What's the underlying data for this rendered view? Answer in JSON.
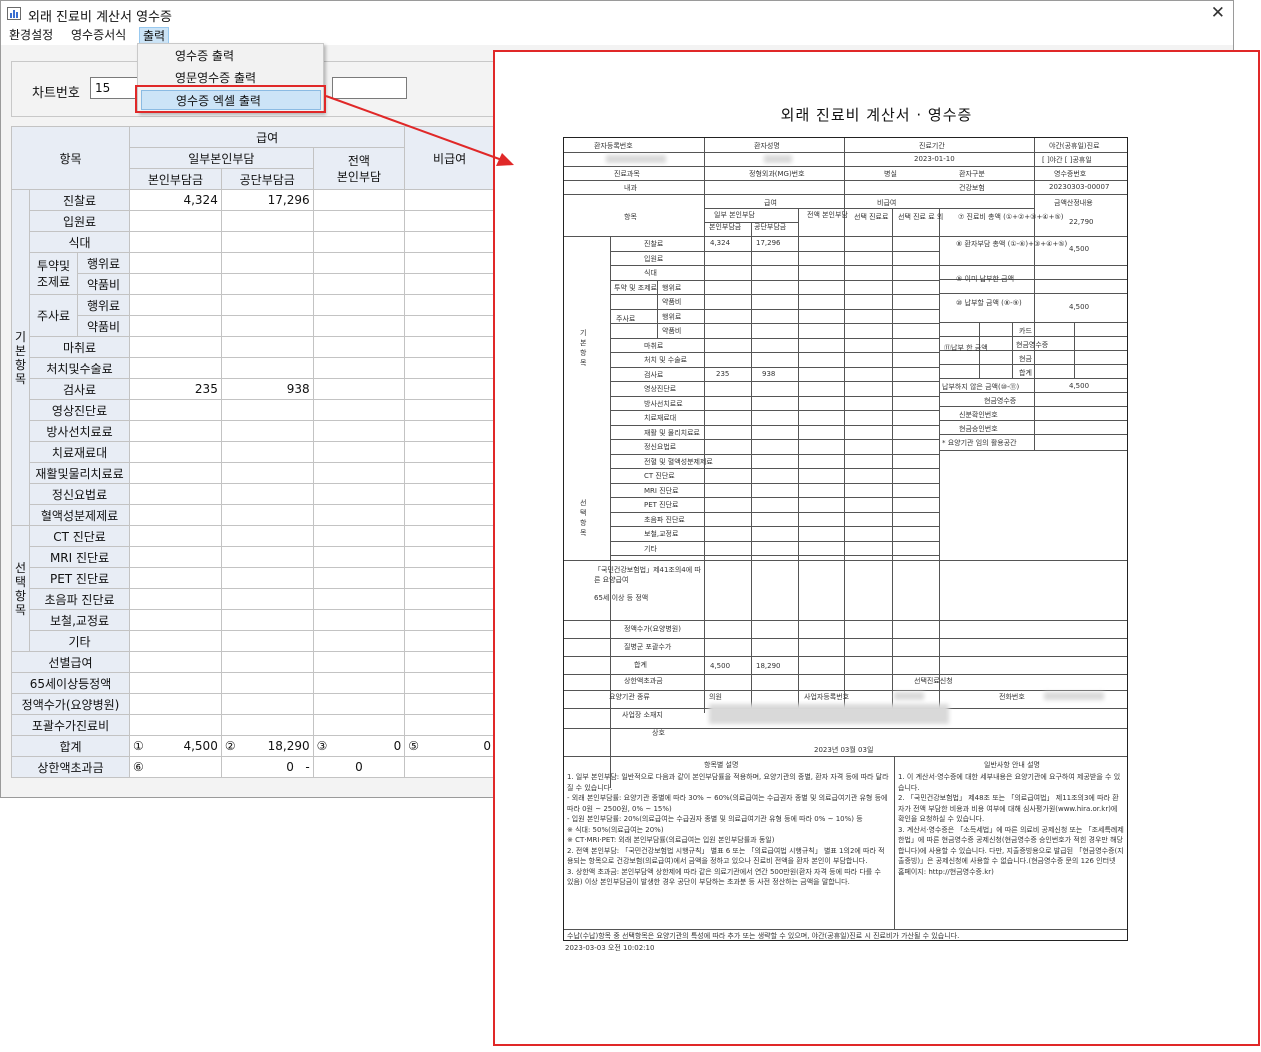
{
  "window": {
    "title": "외래 진료비 계산서 영수증",
    "close_glyph": "✕"
  },
  "menu": {
    "settings": "환경설정",
    "receipt_format": "영수증서식",
    "output": "출력"
  },
  "dropdown": {
    "items": [
      "영수증 출력",
      "영문영수증 출력",
      "영수증 엑셀 출력"
    ]
  },
  "chart": {
    "label": "차트번호",
    "value": "15"
  },
  "grid": {
    "h_item": "항목",
    "h_insured": "급여",
    "h_partial": "일부본인부담",
    "h_full": "전액\n본인부담",
    "h_noncovered": "비급여",
    "h_patient": "본인부담금",
    "h_corp": "공단부담금",
    "group_basic": "기\n본\n항\n목",
    "group_select": "선\n택\n항\n목",
    "rows": [
      {
        "label": "진찰료",
        "patient": "4,324",
        "corp": "17,296"
      },
      {
        "label": "입원료"
      },
      {
        "label": "식대"
      },
      {
        "label": "행위료",
        "group": "투약및\n조제료"
      },
      {
        "label": "약품비"
      },
      {
        "label": "행위료",
        "group": "주사료"
      },
      {
        "label": "약품비"
      },
      {
        "label": "마취료"
      },
      {
        "label": "처치및수술료"
      },
      {
        "label": "검사료",
        "patient": "235",
        "corp": "938"
      },
      {
        "label": "영상진단료"
      },
      {
        "label": "방사선치료료"
      },
      {
        "label": "치료재료대"
      },
      {
        "label": "재활및물리치료료"
      },
      {
        "label": "정신요법료"
      },
      {
        "label": "혈액성분제제료"
      },
      {
        "label": "CT 진단료"
      },
      {
        "label": "MRI 진단료"
      },
      {
        "label": "PET 진단료"
      },
      {
        "label": "초음파 진단료"
      },
      {
        "label": "보철,교정료"
      },
      {
        "label": "기타"
      }
    ],
    "extra_rows": [
      "선별급여",
      "65세이상등정액",
      "정액수가(요양병원)",
      "포괄수가진료비"
    ],
    "total": {
      "label": "합계",
      "m1": "①",
      "v1": "4,500",
      "m2": "②",
      "v2": "18,290",
      "m3": "③",
      "v3": "0",
      "m5": "⑤",
      "v5": "0"
    },
    "excess": {
      "label": "상한액초과금",
      "m6": "⑥",
      "v_a": "0",
      "dash": "-",
      "v_b": "0"
    }
  },
  "preview": {
    "title": "외래 진료비 계산서 · 영수증",
    "h_patient_id": "환자등록번호",
    "h_patient_name": "환자성명",
    "h_period": "진료기간",
    "h_night": "야간(공휴일)진료",
    "period_value": "2023-01-10",
    "night_value": "[ ]야간 [ ]공휴일",
    "h_dept": "진료과목",
    "dept_value": "정형외과(MG)번호",
    "h_ward": "병실",
    "h_type": "환자구분",
    "h_receipt": "영수증번호",
    "h_room": "내과",
    "type_value": "건강보험",
    "receipt_value": "20230303-00007",
    "h_items": "항목",
    "h_insured": "급여",
    "h_noncovered": "비급여",
    "h_calc": "금액산정내용",
    "h_partial": "일부 본인부담",
    "h_full": "전액 본인부담",
    "h_patient": "본인부담금",
    "h_corp": "공단부담금",
    "h_select": "선택 진료료",
    "h_other": "선택 진료 료 외",
    "calc_total": "⑦ 진료비 총액 (①+②+③+④+⑤)",
    "calc_total_value": "22,790",
    "calc_patient": "⑧ 환자부담 총액 (①-⑥)+③+④+⑤)",
    "calc_patient_value": "4,500",
    "calc_paid": "⑨ 이미 납부한 금액",
    "calc_due": "⑩ 납부할 금액 (⑧-⑨)",
    "calc_due_value": "4,500",
    "pay_label": "⑪납부 한 금액",
    "pay_card": "카드",
    "pay_cash_receipt": "현금영수증",
    "pay_cash": "현금",
    "pay_sum": "합계",
    "unpaid": "납부하지 않은 금액(⑩-⑪)",
    "unpaid_value": "4,500",
    "cash_receipt": "현금영수증",
    "id_no": "신분확인번호",
    "approval": "현금승인번호",
    "note_star": "* 요양기관 임의 활용공간",
    "basic_group": "기\n본\n항\n목",
    "select_group": "선\n택\n항\n목",
    "rows": [
      "진찰료",
      "입원료",
      "식대",
      "행위료",
      "약품비",
      "행위료",
      "약품비",
      "마취료",
      "처치 및 수술료",
      "검사료",
      "영상진단료",
      "방사선치료료",
      "치료재료대",
      "재활 및 물리치료료",
      "정신요법료",
      "전혈 및 혈액성분제제료",
      "CT 진단료",
      "MRI 진단료",
      "PET 진단료",
      "초음파 진단료",
      "보철,교정료",
      "기타"
    ],
    "sub_drug": "투약 및 조제료",
    "sub_inject": "주사료",
    "r1_patient": "4,324",
    "r1_corp": "17,296",
    "r10_patient": "235",
    "r10_corp": "938",
    "law": "「국민건강보험법」제41조의4에 따른 요양급여",
    "age65": "65세 이상 등 정액",
    "nursing": "정액수가(요양병원)",
    "drg": "질병군 포괄수가",
    "sum": "합계",
    "sum_patient": "4,500",
    "sum_corp": "18,290",
    "excess": "상한액초과금",
    "select_req": "선택진료신청",
    "inst_type": "요양기관 종류",
    "inst_type_value": "의원",
    "biz_no": "사업자등록번호",
    "phone": "전화번호",
    "address": "사업장 소재지",
    "name": "상호",
    "date_line": "2023년 03월 03일",
    "notes_left_title": "항목별 설명",
    "notes_right_title": "일반사항 안내 설명",
    "notes_left": "1. 일부 본인부담: 일반적으로 다음과 같이 본인부담률을 적용하며, 요양기관의 종별, 환자 자격 등에 따라 달라질 수 있습니다.\n - 외래 본인부담률: 요양기관 종별에 따라 30% ~ 60%(의료급여는 수급권자 종별 및 의료급여기관 유형 등에 따라 0원 ~ 2500원, 0% ~ 15%)\n - 입원 본인부담률: 20%(의료급여는 수급권자 종별 및 의료급여기관 유형 등에 따라 0% ~ 10%) 등\n ※ 식대: 50%(의료급여는 20%)\n ※ CT·MRI·PET: 외래 본인부담률(의료급여는 입원 본인부담률과 동일)\n2. 전액 본인부담: 「국민건강보험법 시행규칙」 별표 6 또는 「의료급여법 시행규칙」 별표 1의2에 따라 적용되는 항목으로 건강보험(의료급여)에서 금액을 정하고 있으나 진료비 전액을 환자 본인이 부담합니다.\n3. 상한액 초과금: 본인부담액 상한제에 따라 같은 의료기관에서 연간 500만원(환자 자격 등에 따라 다를 수 있음) 이상 본인부담금이 발생한 경우 공단이 부담하는 초과분 등 사전 정산하는 금액을 말합니다.",
    "notes_right": "1. 이 계산서·영수증에 대한 세부내용은 요양기관에 요구하여 제공받을 수 있습니다.\n2. 「국민건강보험법」 제48조 또는 「의료급여법」 제11조의3에 따라 환자가 전액 부담한 비용과 비용 여부에 대해 심사평가원(www.hira.or.kr)에 확인을 요청하실 수 있습니다.\n3. 계산서·영수증은 「소득세법」에 따른 의료비 공제신청 또는 「조세특례제한법」에 따른 현금영수증 공제신청(현금영수증 승인번호가 적힌 경우만 해당합니다)에 사용할 수 있습니다. 다만, 지출증빙용으로 발급된 「현금영수증(지출증빙)」은 공제신청에 사용할 수 없습니다.(현금영수증 문의 126 인터넷 홈페이지: http://현금영수증.kr)",
    "bottom_note": "수납(수납)항목 중 선택항목은 요양기관의 특성에 따라 추가 또는 생략할 수 있으며, 야간(공휴일)진료 시 진료비가 가산될 수 있습니다.",
    "timestamp": "2023-03-03 오전 10:02:10"
  },
  "colors": {
    "accent_red": "#e02828",
    "menu_highlight": "#cce4f7",
    "grid_header": "#e8edf5"
  }
}
